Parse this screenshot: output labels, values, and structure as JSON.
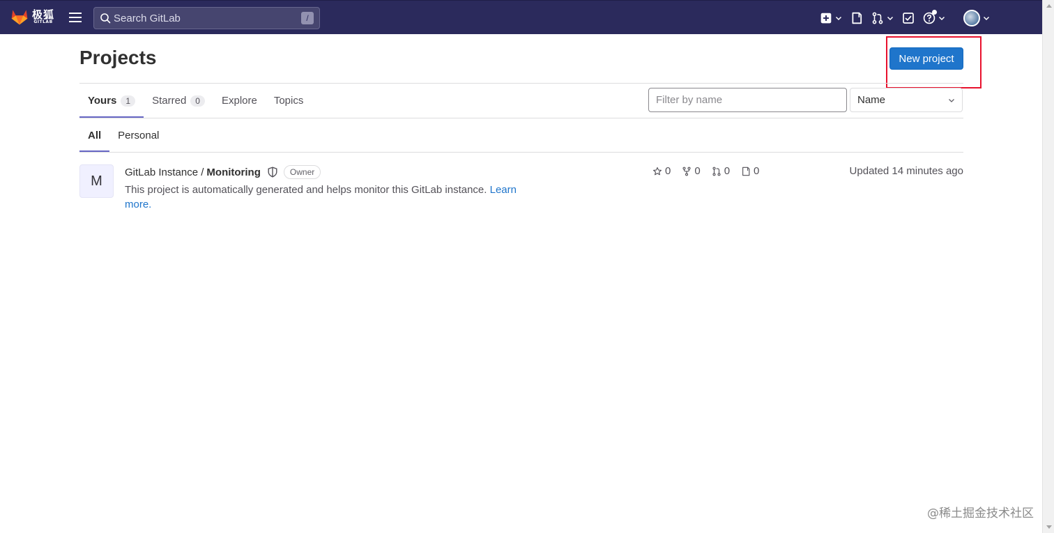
{
  "navbar": {
    "logo_cn": "极狐",
    "logo_en": "GITLAB",
    "search_placeholder": "Search GitLab",
    "search_shortcut": "/",
    "icons": [
      "plus-square-icon",
      "issues-icon",
      "merge-request-icon",
      "todo-icon",
      "help-icon",
      "user-avatar"
    ]
  },
  "page": {
    "title": "Projects",
    "new_project_label": "New project"
  },
  "tabs": [
    {
      "label": "Yours",
      "count": "1"
    },
    {
      "label": "Starred",
      "count": "0"
    },
    {
      "label": "Explore"
    },
    {
      "label": "Topics"
    }
  ],
  "filter": {
    "placeholder": "Filter by name",
    "sort_label": "Name"
  },
  "subtabs": [
    {
      "label": "All"
    },
    {
      "label": "Personal"
    }
  ],
  "project": {
    "avatar_letter": "M",
    "namespace": "GitLab Instance /",
    "name": "Monitoring",
    "role": "Owner",
    "description": "This project is automatically generated and helps monitor this GitLab instance.",
    "learn_more": "Learn more.",
    "stars": "0",
    "forks": "0",
    "merge_requests": "0",
    "issues": "0",
    "updated": "Updated 14 minutes ago"
  },
  "watermark": "@稀土掘金技术社区",
  "colors": {
    "navbar_bg": "#2b2a5c",
    "primary_button": "#1f75cb",
    "active_tab_underline": "#6666c4",
    "highlight_box": "#e8112d"
  }
}
